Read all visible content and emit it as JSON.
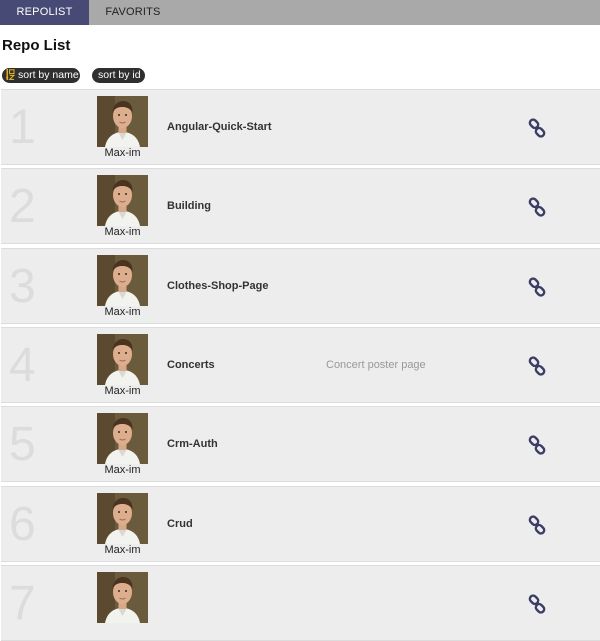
{
  "nav": {
    "tabs": [
      {
        "label": "REPOLIST",
        "active": true
      },
      {
        "label": "FAVORITS",
        "active": false
      }
    ]
  },
  "page": {
    "title": "Repo List"
  },
  "sort": {
    "by_name_label": "sort by name",
    "by_name_icon": "sort-alpha-icon",
    "by_id_label": "sort by id"
  },
  "repos": [
    {
      "index": "1",
      "owner": "Max-im",
      "name": "Angular-Quick-Start",
      "description": ""
    },
    {
      "index": "2",
      "owner": "Max-im",
      "name": "Building",
      "description": ""
    },
    {
      "index": "3",
      "owner": "Max-im",
      "name": "Clothes-Shop-Page",
      "description": ""
    },
    {
      "index": "4",
      "owner": "Max-im",
      "name": "Concerts",
      "description": "Concert poster page"
    },
    {
      "index": "5",
      "owner": "Max-im",
      "name": "Crm-Auth",
      "description": ""
    },
    {
      "index": "6",
      "owner": "Max-im",
      "name": "Crud",
      "description": ""
    },
    {
      "index": "7",
      "owner": "",
      "name": "",
      "description": ""
    }
  ],
  "colors": {
    "accent": "#484a76",
    "row_bg": "#ededed",
    "link_icon": "#3b3d66",
    "sort_icon": "#e8b923"
  }
}
